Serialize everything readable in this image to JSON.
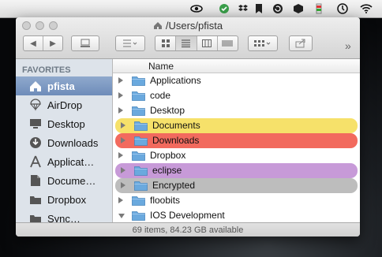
{
  "menubar": {
    "icons": [
      "eye-icon",
      "sync-icon",
      "dropbox-icon",
      "bookmark-icon",
      "refresh-icon",
      "box-icon",
      "battery-meter-icon",
      "time-machine-icon",
      "wifi-icon"
    ]
  },
  "window": {
    "title": "/Users/pfista",
    "status": "69 items, 84.23 GB available"
  },
  "sidebar": {
    "heading": "FAVORITES",
    "items": [
      {
        "label": "pfista",
        "icon": "home-icon",
        "selected": true
      },
      {
        "label": "AirDrop",
        "icon": "airdrop-icon"
      },
      {
        "label": "Desktop",
        "icon": "desktop-icon"
      },
      {
        "label": "Downloads",
        "icon": "downloads-icon"
      },
      {
        "label": "Applicat…",
        "icon": "applications-icon"
      },
      {
        "label": "Docume…",
        "icon": "documents-icon"
      },
      {
        "label": "Dropbox",
        "icon": "folder-icon"
      },
      {
        "label": "Sync…",
        "icon": "folder-icon"
      }
    ]
  },
  "list": {
    "column_name": "Name",
    "rows": [
      {
        "name": "Applications",
        "label_color": "",
        "expanded": false
      },
      {
        "name": "code",
        "label_color": "",
        "expanded": false
      },
      {
        "name": "Desktop",
        "label_color": "",
        "expanded": false
      },
      {
        "name": "Documents",
        "label_color": "#f6e16a",
        "expanded": false
      },
      {
        "name": "Downloads",
        "label_color": "#f26a5e",
        "expanded": false
      },
      {
        "name": "Dropbox",
        "label_color": "",
        "expanded": false
      },
      {
        "name": "eclipse",
        "label_color": "#c79ad8",
        "expanded": false
      },
      {
        "name": "Encrypted",
        "label_color": "#bdbdbd",
        "expanded": false
      },
      {
        "name": "floobits",
        "label_color": "",
        "expanded": false
      },
      {
        "name": "IOS Development",
        "label_color": "",
        "expanded": true
      }
    ]
  },
  "colors": {
    "sidebar_bg": "#dde3ea",
    "selection": "#7f9bc4",
    "folder": "#6aa9de"
  }
}
